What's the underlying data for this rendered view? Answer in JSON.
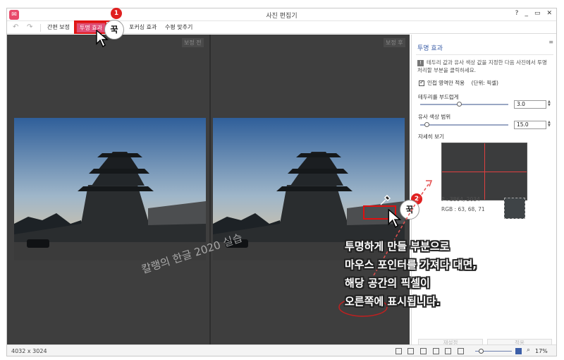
{
  "window": {
    "title": "사진 편집기",
    "buttons": [
      "?",
      "_",
      "▭",
      "✕"
    ]
  },
  "toolbar": {
    "tabs": [
      "간편 보정",
      "투명 효과",
      "포커싱 효과",
      "수평 맞추기"
    ],
    "active_tab": "투명 효과"
  },
  "canvas": {
    "before_label": "보정 전",
    "after_label": "보정 후",
    "watermark": "칼랭의 한글 2020 실습"
  },
  "sidebar": {
    "heading": "투명 효과",
    "description": "테두리 값과 유사 색상 값을 지정한 다음 사진에서 투명 처리할 부분을 클릭하세요.",
    "checkbox_label": "인접 영역만 적용",
    "checkbox_unit": "(단위: 픽셀)",
    "edge_label": "테두리를 부드럽게",
    "edge_value": "3.0",
    "edge_fraction": 0.44,
    "similar_label": "유사 색상 범위",
    "similar_value": "15.0",
    "similar_fraction": 0.07,
    "detail_label": "자세히 보기",
    "coords": "3864, 2034",
    "coords_prefix": "P",
    "rgb": "RGB : 63, 68, 71",
    "reset_button": "재설정",
    "apply_button": "적용",
    "swatch_color": "#3f4447"
  },
  "status": {
    "dimensions": "4032 x 3024",
    "zoom": "17%"
  },
  "annotations": {
    "badge1": "1",
    "badge2": "2",
    "press": "꾹",
    "callout": [
      "투명하게 만들 부분으로",
      "마우스 포인터를 가져다 대면,",
      "해당 공간의 픽셀이",
      "오른쪽에 표시됩니다."
    ],
    "accent": "#e02020"
  }
}
